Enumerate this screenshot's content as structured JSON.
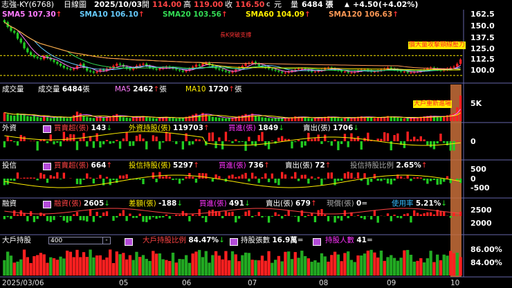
{
  "header": {
    "stock": "志強-KY(6768)",
    "period": "日線圖",
    "date": "2025/10/03",
    "open_label": "開",
    "open": "114.00",
    "high_label": "高",
    "high": "119.00",
    "close_label": "收",
    "close": "116.50",
    "unit": "元",
    "vol_label": "量",
    "volume": "6484 張",
    "change": "+4.50",
    "change_pct": "(+4.02%)"
  },
  "ma": [
    {
      "name": "SMA5",
      "value": "107.30",
      "dir": "↑",
      "color": "#ff7bff"
    },
    {
      "name": "SMA10",
      "value": "106.10",
      "dir": "↑",
      "color": "#66ccff"
    },
    {
      "name": "SMA20",
      "value": "103.56",
      "dir": "↑",
      "color": "#33dd55"
    },
    {
      "name": "SMA60",
      "value": "104.09",
      "dir": "↑",
      "color": "#ffee00"
    },
    {
      "name": "SMA120",
      "value": "106.63",
      "dir": "↑",
      "color": "#ff9955"
    }
  ],
  "price_axis": [
    "162.5",
    "150.0",
    "137.5",
    "125.0",
    "112.5",
    "100.0"
  ],
  "annotations": {
    "a1": "長K突破支撐",
    "a2": "價大量攻擊頸線壓力",
    "a3": "大戶重新進場"
  },
  "volume_panel": {
    "title": "成交量",
    "v_label": "成交量",
    "v_value": "6484",
    "v_unit": "張",
    "ma5_label": "MA5",
    "ma5_value": "2462",
    "ma5_dir": "↑",
    "ma5_unit": "張",
    "ma10_label": "MA10",
    "ma10_value": "1720",
    "ma10_dir": "↑",
    "ma10_unit": "張",
    "axis": "5K"
  },
  "foreign_panel": {
    "title": "外資",
    "net_label": "買賣超(張)",
    "net_value": "143",
    "net_dir": "↓",
    "hold_label": "外資持股(張)",
    "hold_value": "119703",
    "hold_dir": "↑",
    "buy_label": "買進(張)",
    "buy_value": "1849",
    "buy_dir": "↓",
    "sell_label": "賣出(張)",
    "sell_value": "1706",
    "sell_dir": "↓",
    "axis": "0"
  },
  "trust_panel": {
    "title": "投信",
    "net_label": "買賣超(張)",
    "net_value": "664",
    "net_dir": "↑",
    "hold_label": "投信持股(張)",
    "hold_value": "5297",
    "hold_dir": "↑",
    "buy_label": "買進(張)",
    "buy_value": "736",
    "buy_dir": "↑",
    "sell_label": "賣出(張)",
    "sell_value": "72",
    "sell_dir": "↑",
    "ratio_label": "投信持股比例",
    "ratio_value": "2.65%",
    "ratio_dir": "↑",
    "axis": [
      "500",
      "0",
      "-500"
    ]
  },
  "margin_panel": {
    "title": "融資",
    "bal_label": "融資(張)",
    "bal_value": "2605",
    "bal_dir": "↓",
    "diff_label": "差額(張)",
    "diff_value": "-188",
    "diff_dir": "↓",
    "buy_label": "買進(張)",
    "buy_value": "491",
    "buy_dir": "↓",
    "sell_label": "賣出(張)",
    "sell_value": "679",
    "sell_dir": "↑",
    "cash_label": "現償(張)",
    "cash_value": "0",
    "cash_dir": "=",
    "use_label": "使用率",
    "use_value": "5.21%",
    "use_dir": "↓",
    "axis": [
      "2500",
      "2000"
    ]
  },
  "holder_panel": {
    "title": "大戶持股",
    "stepper_value": "400",
    "stepper_btn": "-",
    "ratio_label": "大戶持股比例",
    "ratio_value": "84.47%",
    "ratio_dir": "↓",
    "count_label": "持股張數",
    "count_value": "16.9萬",
    "count_dir": "=",
    "people_label": "持股人數",
    "people_value": "41",
    "people_dir": "=",
    "axis": [
      "86.00%",
      "84.00%"
    ]
  },
  "x_labels": [
    "2025/03/06",
    "05",
    "06",
    "07",
    "08",
    "09",
    "10"
  ],
  "chart_data": {
    "type": "candlestick",
    "title": "志強-KY(6768) 日線圖",
    "ylim": [
      95,
      165
    ],
    "x_labels": [
      "2025/03/06",
      "05",
      "06",
      "07",
      "08",
      "09",
      "10"
    ],
    "colors": {
      "up": "#ff2020",
      "down": "#22cc22",
      "highlight": "#c86e3a"
    },
    "resistance_line": 120.5,
    "support_line": 100.0,
    "closes": [
      155,
      150,
      146,
      144,
      138,
      134,
      128,
      124,
      121,
      119,
      118,
      117,
      120,
      118,
      116,
      114,
      112,
      110,
      108,
      107,
      106,
      107,
      110,
      112,
      108,
      105,
      104,
      103,
      104,
      106,
      105,
      107,
      108,
      110,
      112,
      111,
      109,
      107,
      106,
      108,
      110,
      111,
      112,
      110,
      108,
      107,
      106,
      107,
      108,
      109,
      108,
      107,
      106,
      105,
      104,
      105,
      107,
      109,
      111,
      110,
      112,
      113,
      111,
      109,
      107,
      106,
      105,
      104,
      103,
      104,
      106,
      108,
      110,
      112,
      113,
      114,
      112,
      110,
      109,
      108,
      107,
      106,
      105,
      104,
      103,
      103,
      104,
      105,
      106,
      107,
      107,
      106,
      105,
      104,
      104,
      105,
      106,
      107,
      108,
      107,
      106,
      105,
      104,
      104,
      103,
      103,
      104,
      105,
      106,
      106,
      105,
      104,
      104,
      105,
      106,
      107,
      108,
      107,
      106,
      105,
      104,
      104,
      103,
      103,
      104,
      104,
      105,
      106,
      107,
      108,
      107,
      106,
      105,
      106,
      107,
      108,
      109,
      112,
      116.5
    ],
    "volume": [
      2200,
      1800,
      1500,
      1400,
      2000,
      1700,
      1600,
      1300,
      1200,
      1400,
      1100,
      900,
      1300,
      1000,
      800,
      900,
      1100,
      1200,
      900,
      800,
      1000,
      1500,
      2400,
      2000,
      1300,
      1100,
      900,
      800,
      1000,
      1200,
      900,
      1100,
      1300,
      1500,
      1800,
      1300,
      1000,
      900,
      800,
      1000,
      1200,
      1100,
      1300,
      1000,
      900,
      800,
      700,
      900,
      1000,
      1100,
      900,
      800,
      700,
      800,
      900,
      1100,
      1300,
      1600,
      1900,
      1500,
      2100,
      1800,
      1300,
      1100,
      1000,
      900,
      800,
      700,
      800,
      900,
      1100,
      1300,
      1500,
      1800,
      1600,
      1900,
      1400,
      1200,
      1000,
      900,
      800,
      700,
      800,
      900,
      700,
      800,
      900,
      1000,
      1200,
      1100,
      1000,
      900,
      800,
      700,
      800,
      900,
      1000,
      1100,
      1200,
      1000,
      900,
      800,
      700,
      800,
      900,
      800,
      1000,
      1100,
      1200,
      1100,
      1000,
      900,
      800,
      900,
      1000,
      1100,
      1300,
      1200,
      1000,
      900,
      800,
      700,
      800,
      900,
      1000,
      900,
      1100,
      1200,
      1300,
      1400,
      1200,
      1000,
      1100,
      1300,
      1500,
      1700,
      2000,
      3500,
      6484
    ]
  }
}
